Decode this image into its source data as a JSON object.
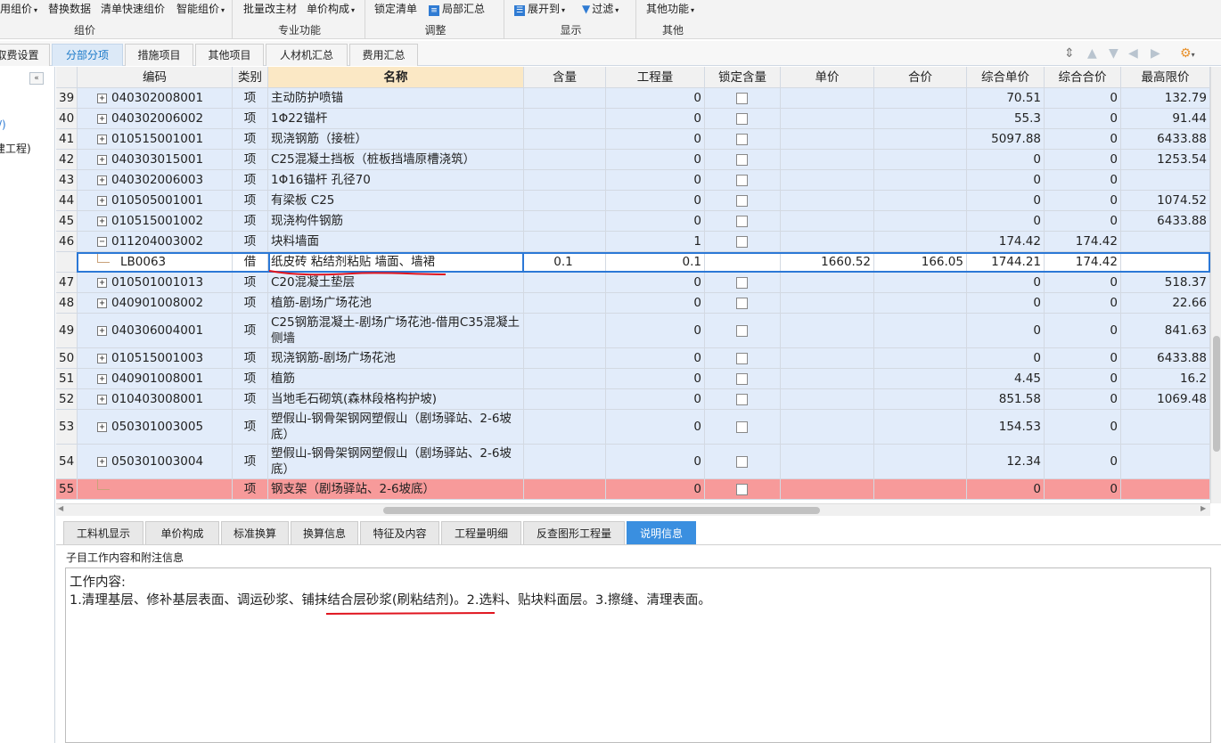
{
  "ribbon": {
    "groups": [
      {
        "caption": "组价",
        "buttons": [
          "用组价",
          "替换数据",
          "清单快速组价",
          "智能组价"
        ]
      },
      {
        "caption": "专业功能",
        "buttons": [
          "批量改主材",
          "单价构成"
        ]
      },
      {
        "caption": "调整",
        "buttons": [
          "锁定清单",
          "局部汇总"
        ]
      },
      {
        "caption": "显示",
        "buttons": [
          "展开到",
          "过滤"
        ]
      },
      {
        "caption": "其他",
        "buttons": [
          "其他功能"
        ]
      }
    ]
  },
  "tabs": [
    "取费设置",
    "分部分项",
    "措施项目",
    "其他项目",
    "人材机汇总",
    "费用汇总"
  ],
  "active_tab": "分部分项",
  "left_panel": {
    "collapse_label": "«",
    "items": [
      "/)",
      "建工程)"
    ]
  },
  "grid": {
    "columns": [
      "编码",
      "类别",
      "名称",
      "含量",
      "工程量",
      "锁定含量",
      "单价",
      "合价",
      "综合单价",
      "综合合价",
      "最高限价"
    ],
    "rows": [
      {
        "idx": "39",
        "code": "040302008001",
        "type": "项",
        "name": "主动防护喷锚",
        "content": "",
        "qty": "0",
        "lock": true,
        "price": "",
        "total": "",
        "unit_price": "70.51",
        "unit_total": "0",
        "max": "132.79",
        "expander": "+"
      },
      {
        "idx": "40",
        "code": "040302006002",
        "type": "项",
        "name": "1Φ22锚杆",
        "content": "",
        "qty": "0",
        "lock": true,
        "price": "",
        "total": "",
        "unit_price": "55.3",
        "unit_total": "0",
        "max": "91.44",
        "expander": "+"
      },
      {
        "idx": "41",
        "code": "010515001001",
        "type": "项",
        "name": "现浇钢筋（接桩）",
        "content": "",
        "qty": "0",
        "lock": true,
        "price": "",
        "total": "",
        "unit_price": "5097.88",
        "unit_total": "0",
        "max": "6433.88",
        "expander": "+"
      },
      {
        "idx": "42",
        "code": "040303015001",
        "type": "项",
        "name": "C25混凝土挡板（桩板挡墙原槽浇筑）",
        "content": "",
        "qty": "0",
        "lock": true,
        "price": "",
        "total": "",
        "unit_price": "0",
        "unit_total": "0",
        "max": "1253.54",
        "expander": "+"
      },
      {
        "idx": "43",
        "code": "040302006003",
        "type": "项",
        "name": "1Φ16锚杆 孔径70",
        "content": "",
        "qty": "0",
        "lock": true,
        "price": "",
        "total": "",
        "unit_price": "0",
        "unit_total": "0",
        "max": "",
        "expander": "+"
      },
      {
        "idx": "44",
        "code": "010505001001",
        "type": "项",
        "name": "有梁板 C25",
        "content": "",
        "qty": "0",
        "lock": true,
        "price": "",
        "total": "",
        "unit_price": "0",
        "unit_total": "0",
        "max": "1074.52",
        "expander": "+"
      },
      {
        "idx": "45",
        "code": "010515001002",
        "type": "项",
        "name": "现浇构件钢筋",
        "content": "",
        "qty": "0",
        "lock": true,
        "price": "",
        "total": "",
        "unit_price": "0",
        "unit_total": "0",
        "max": "6433.88",
        "expander": "+"
      },
      {
        "idx": "46",
        "code": "011204003002",
        "type": "项",
        "name": "块料墙面",
        "content": "",
        "qty": "1",
        "lock": true,
        "price": "",
        "total": "",
        "unit_price": "174.42",
        "unit_total": "174.42",
        "max": "",
        "expander": "−"
      },
      {
        "idx": "",
        "code": "LB0063",
        "type": "借",
        "name": "纸皮砖 粘结剂粘贴 墙面、墙裙",
        "content": "0.1",
        "qty": "0.1",
        "lock": false,
        "price": "1660.52",
        "total": "166.05",
        "unit_price": "1744.21",
        "unit_total": "174.42",
        "max": "",
        "expander": ""
      },
      {
        "idx": "47",
        "code": "010501001013",
        "type": "项",
        "name": "C20混凝土垫层",
        "content": "",
        "qty": "0",
        "lock": true,
        "price": "",
        "total": "",
        "unit_price": "0",
        "unit_total": "0",
        "max": "518.37",
        "expander": "+"
      },
      {
        "idx": "48",
        "code": "040901008002",
        "type": "项",
        "name": "植筋-剧场广场花池",
        "content": "",
        "qty": "0",
        "lock": true,
        "price": "",
        "total": "",
        "unit_price": "0",
        "unit_total": "0",
        "max": "22.66",
        "expander": "+"
      },
      {
        "idx": "49",
        "code": "040306004001",
        "type": "项",
        "name": "C25钢筋混凝土-剧场广场花池-借用C35混凝土侧墙",
        "content": "",
        "qty": "0",
        "lock": true,
        "price": "",
        "total": "",
        "unit_price": "0",
        "unit_total": "0",
        "max": "841.63",
        "expander": "+"
      },
      {
        "idx": "50",
        "code": "010515001003",
        "type": "项",
        "name": "现浇钢筋-剧场广场花池",
        "content": "",
        "qty": "0",
        "lock": true,
        "price": "",
        "total": "",
        "unit_price": "0",
        "unit_total": "0",
        "max": "6433.88",
        "expander": "+"
      },
      {
        "idx": "51",
        "code": "040901008001",
        "type": "项",
        "name": "植筋",
        "content": "",
        "qty": "0",
        "lock": true,
        "price": "",
        "total": "",
        "unit_price": "4.45",
        "unit_total": "0",
        "max": "16.2",
        "expander": "+"
      },
      {
        "idx": "52",
        "code": "010403008001",
        "type": "项",
        "name": "当地毛石砌筑(森林段格构护坡)",
        "content": "",
        "qty": "0",
        "lock": true,
        "price": "",
        "total": "",
        "unit_price": "851.58",
        "unit_total": "0",
        "max": "1069.48",
        "expander": "+"
      },
      {
        "idx": "53",
        "code": "050301003005",
        "type": "项",
        "name": "塑假山-钢骨架钢网塑假山（剧场驿站、2-6坡底）",
        "content": "",
        "qty": "0",
        "lock": true,
        "price": "",
        "total": "",
        "unit_price": "154.53",
        "unit_total": "0",
        "max": "",
        "expander": "+"
      },
      {
        "idx": "54",
        "code": "050301003004",
        "type": "项",
        "name": "塑假山-钢骨架钢网塑假山（剧场驿站、2-6坡底）",
        "content": "",
        "qty": "0",
        "lock": true,
        "price": "",
        "total": "",
        "unit_price": "12.34",
        "unit_total": "0",
        "max": "",
        "expander": "+"
      },
      {
        "idx": "55",
        "code": "",
        "type": "项",
        "name": "钢支架（剧场驿站、2-6坡底）",
        "content": "",
        "qty": "0",
        "lock": true,
        "price": "",
        "total": "",
        "unit_price": "0",
        "unit_total": "0",
        "max": "",
        "expander": ""
      }
    ]
  },
  "bottom_tabs": [
    "工料机显示",
    "单价构成",
    "标准换算",
    "换算信息",
    "特征及内容",
    "工程量明细",
    "反查图形工程量",
    "说明信息"
  ],
  "active_bottom_tab": "说明信息",
  "notes": {
    "label": "子目工作内容和附注信息",
    "title": "工作内容:",
    "body": "1.清理基层、修补基层表面、调运砂浆、铺抹结合层砂浆(刷粘结剂)。2.选料、贴块料面层。3.擦缝、清理表面。"
  },
  "colors": {
    "row_bg": "#e2ecfa",
    "highlight_row": "#f79a9a",
    "accent": "#3a8fe0",
    "annotation": "#e0141e"
  },
  "icons": [
    "triangle-down-icon",
    "list-icon",
    "expand-icon",
    "filter-icon",
    "sort-icon",
    "arrow-up-icon",
    "arrow-down-icon",
    "arrow-left-icon",
    "arrow-right-icon",
    "settings-icon"
  ]
}
